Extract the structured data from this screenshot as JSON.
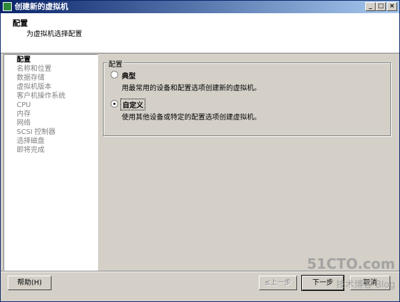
{
  "window": {
    "title": "创建新的虚拟机"
  },
  "header": {
    "title": "配置",
    "subtitle": "为虚拟机选择配置"
  },
  "nav": {
    "items": [
      {
        "label": "配置"
      },
      {
        "label": "名称和位置"
      },
      {
        "label": "数据存储"
      },
      {
        "label": "虚拟机版本"
      },
      {
        "label": "客户机操作系统"
      },
      {
        "label": "CPU"
      },
      {
        "label": "内存"
      },
      {
        "label": "网络"
      },
      {
        "label": "SCSI 控制器"
      },
      {
        "label": "选择磁盘"
      },
      {
        "label": "即将完成"
      }
    ]
  },
  "config": {
    "legend": "配置",
    "typical": {
      "label": "典型",
      "desc": "用最常用的设备和配置选项创建新的虚拟机。",
      "selected": false
    },
    "custom": {
      "label": "自定义",
      "desc": "使用其他设备或特定的配置选项创建虚拟机。",
      "selected": true
    }
  },
  "buttons": {
    "help": "帮助(H)",
    "back": "≤上一步",
    "next": "下一步",
    "cancel": "取消"
  },
  "watermark": {
    "line1": "51CTO.com",
    "line2": "技术博客  Blog"
  }
}
